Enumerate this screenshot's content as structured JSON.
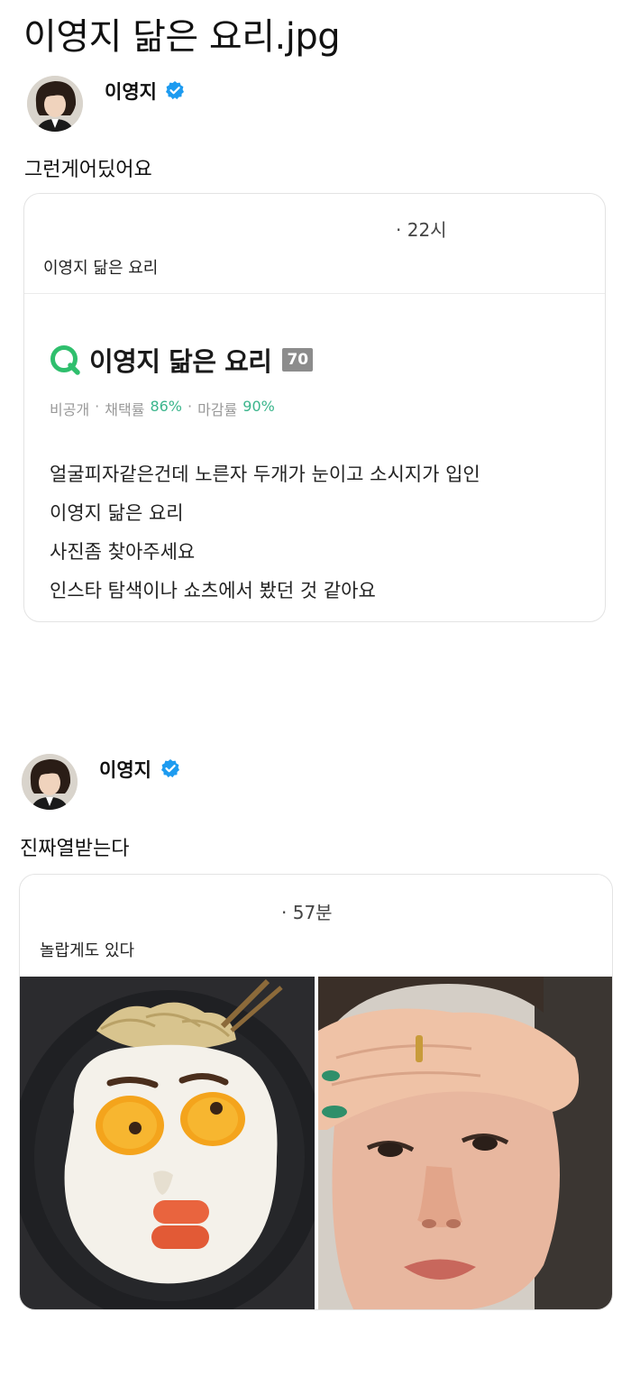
{
  "page_title": "이영지 닮은 요리.jpg",
  "post1": {
    "author": "이영지",
    "text": "그런게어딨어요",
    "quote": {
      "time": "· 22시",
      "text": "이영지 닮은 요리",
      "question": {
        "title": "이영지 닮은 요리",
        "badge": "70",
        "meta_private": "비공개",
        "meta_sep1": "·",
        "meta_adopt_label": "채택률",
        "meta_adopt_value": "86%",
        "meta_sep2": "·",
        "meta_close_label": "마감률",
        "meta_close_value": "90%",
        "body": [
          "얼굴피자같은건데 노른자 두개가 눈이고 소시지가 입인",
          "이영지 닮은 요리",
          "사진좀 찾아주세요",
          "인스타 탐색이나 쇼츠에서 봤던 것 같아요"
        ]
      }
    }
  },
  "post2": {
    "author": "이영지",
    "text": "진짜열받는다",
    "quote": {
      "time": "· 57분",
      "text": "놀랍게도 있다"
    }
  },
  "colors": {
    "verified": "#1d9bf0",
    "accent_green": "#3bb58c",
    "badge_gray": "#8c8c8c"
  },
  "icons": [
    "verified-badge-icon",
    "q-search-icon"
  ]
}
